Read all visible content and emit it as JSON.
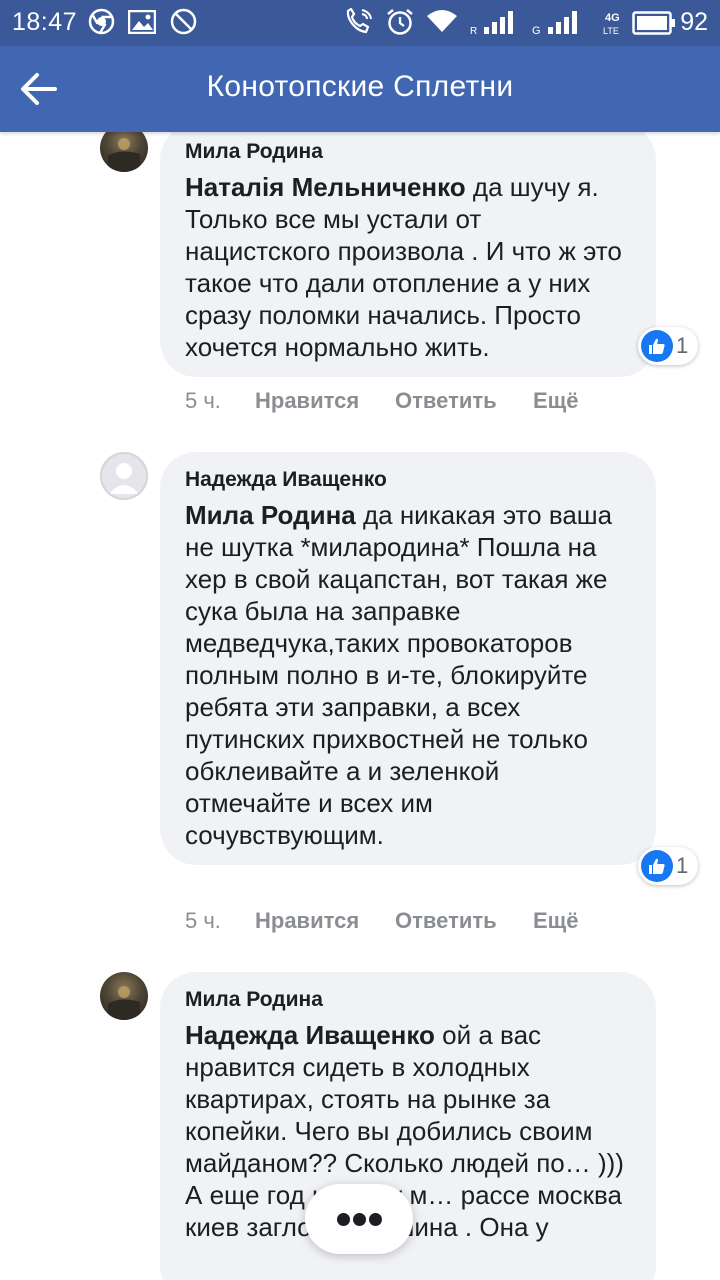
{
  "status_bar": {
    "time": "18:47",
    "battery": "92",
    "left_icons": [
      "chrome-icon",
      "image-icon",
      "do-not-disturb-icon"
    ],
    "right_icons": [
      "wifi-calling-icon",
      "alarm-icon",
      "wifi-icon",
      "signal-r-icon",
      "signal-g-icon",
      "signal-4g-lte-icon",
      "battery-icon"
    ],
    "labels": {
      "r": "R",
      "g": "G",
      "net": "4G",
      "lte": "LTE"
    }
  },
  "app_bar": {
    "title": "Конотопские Сплетни",
    "back_icon": "back-arrow-icon",
    "color": "#4267b2"
  },
  "comments": [
    {
      "author": "Мила Родина",
      "mention": "Наталія Мельниченко",
      "text": "да шучу я. Только все мы устали от нацистского произвола . И что ж это такое что дали отопление а у них сразу поломки начались. Просто хочется нормально жить.",
      "reactions": "1",
      "time": "5 ч.",
      "like": "Нравится",
      "reply": "Ответить",
      "more": "Ещё"
    },
    {
      "author": "Надежда Иващенко",
      "mention": "Мила Родина",
      "text": "да никакая это ваша не шутка *милародина* Пошла на хер в свой кацапстан, вот такая же сука была на заправке медведчука,таких провокаторов полным полно в и-те, блокируйте ребята эти заправки, а всех путинских прихвостней не только обклеивайте а и зеленкой отмечайте и всех им сочувствующим.",
      "reactions": "1",
      "time": "5 ч.",
      "like": "Нравится",
      "reply": "Ответить",
      "more": "Ещё"
    },
    {
      "author": "Мила Родина",
      "mention": "Надежда Иващенко",
      "text": "ой а вас нравится сидеть в холодных квартирах, стоять на рынке за копейки. Чего вы добились своим майданом?? Сколько людей по… ))) А еще год назад у м… рассе москва киев заглохла машина . Она у"
    }
  ],
  "more_button_icon": "more-dots-icon",
  "colors": {
    "status_bar": "#3b5998",
    "bubble": "#f0f2f5",
    "like_blue": "#1877f2",
    "secondary_text": "#8a8d91"
  }
}
